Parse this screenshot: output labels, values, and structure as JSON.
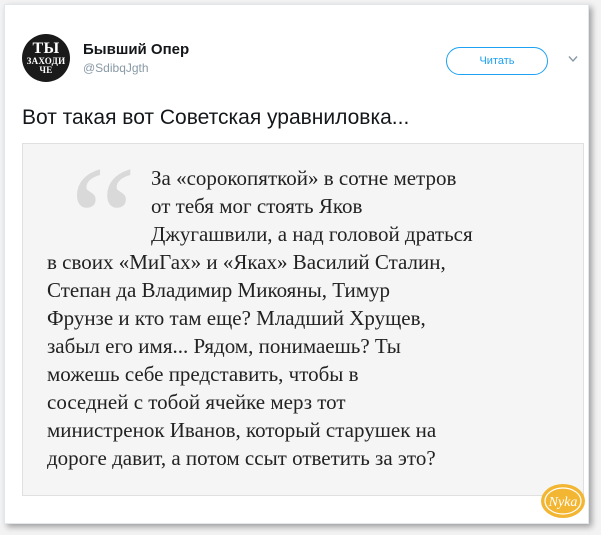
{
  "user": {
    "display_name": "Бывший Опер",
    "handle": "@SdibqJgth",
    "avatar_text_big": "ТЫ",
    "avatar_text_small": "ЗАХОДИ ЧЕ"
  },
  "follow_label": "Читать",
  "tweet_text": "Вот такая вот Советская уравниловка...",
  "quote": {
    "lines": [
      "За «сорокопяткой» в сотне метров",
      "от тебя мог стоять Яков",
      "Джугашвили, а над головой драться",
      "в своих «МиГах» и «Яках» Василий Сталин,",
      "Степан да Владимир Микояны, Тимур",
      "Фрунзе и кто там еще? Младший Хрущев,",
      "забыл его имя... Рядом, понимаешь? Ты",
      "можешь себе представить, чтобы в",
      "соседней с тобой ячейке мерз тот",
      "министренок Иванов, который старушек на",
      "дороге давит, а потом ссыт ответить за это?"
    ]
  },
  "watermark": "Nyka",
  "colors": {
    "accent": "#1da1f2",
    "text": "#14171a",
    "muted": "#8899a6",
    "quote_bg": "#f5f5f5",
    "logo_yellow": "#f2b632"
  }
}
